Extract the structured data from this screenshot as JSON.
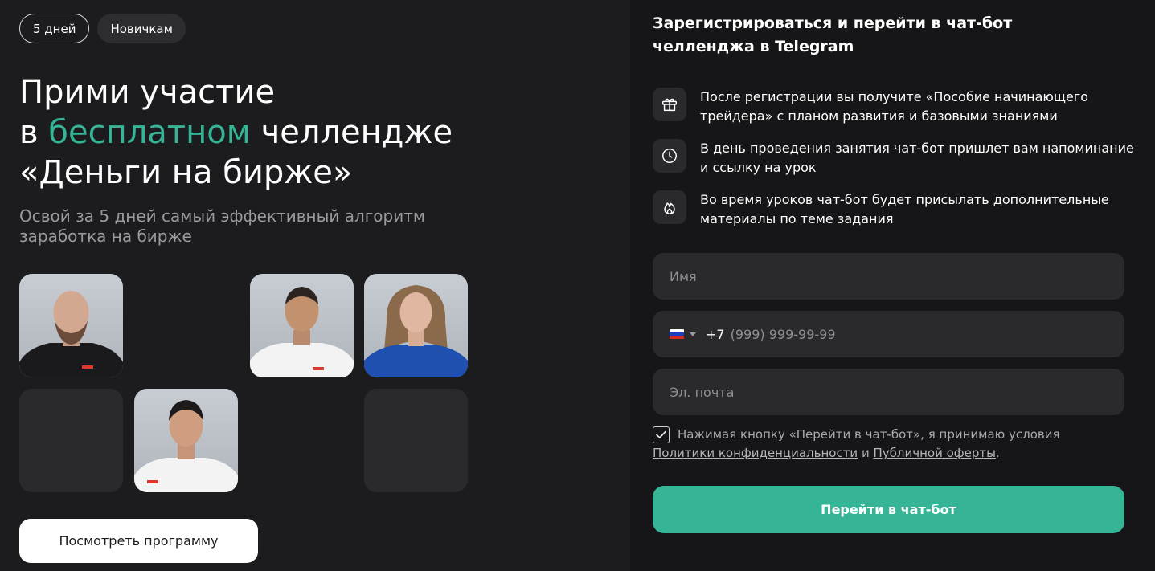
{
  "tags": {
    "duration": "5 дней",
    "level": "Новичкам"
  },
  "hero": {
    "title_line1": "Прими участие",
    "title_line2_pre": "в ",
    "title_line2_accent": "бесплатном",
    "title_line2_post": " челлендже",
    "title_line3": "«Деньги на бирже»",
    "subtitle": "Освой за 5 дней самый эффективный алгоритм заработка на бирже"
  },
  "program_button": "Посмотреть программу",
  "form": {
    "title": "Зарегистрироваться и перейти в чат-бот челленджа в Telegram",
    "features": [
      {
        "icon": "gift-icon",
        "text": "После регистрации вы получите «Пособие начинающего трейдера» с планом развития и базовыми знаниями"
      },
      {
        "icon": "clock-icon",
        "text": "В день проведения занятия чат-бот пришлет вам напоминание и ссылку на урок"
      },
      {
        "icon": "fire-icon",
        "text": "Во время уроков чат-бот будет присылать дополнительные материалы по теме задания"
      }
    ],
    "name_placeholder": "Имя",
    "phone_code": "+7",
    "phone_mask": "(999) 999-99-99",
    "email_placeholder": "Эл. почта",
    "consent_text": "Нажимая кнопку «Перейти в чат-бот», я принимаю условия",
    "privacy_link": "Политики конфиденциальности",
    "conjunction": "и",
    "offer_link": "Публичной оферты",
    "period": ".",
    "submit": "Перейти в чат-бот"
  },
  "colors": {
    "accent": "#35b596",
    "background": "#1c1c1f",
    "panel": "#161618",
    "field": "#2a2a2d"
  }
}
